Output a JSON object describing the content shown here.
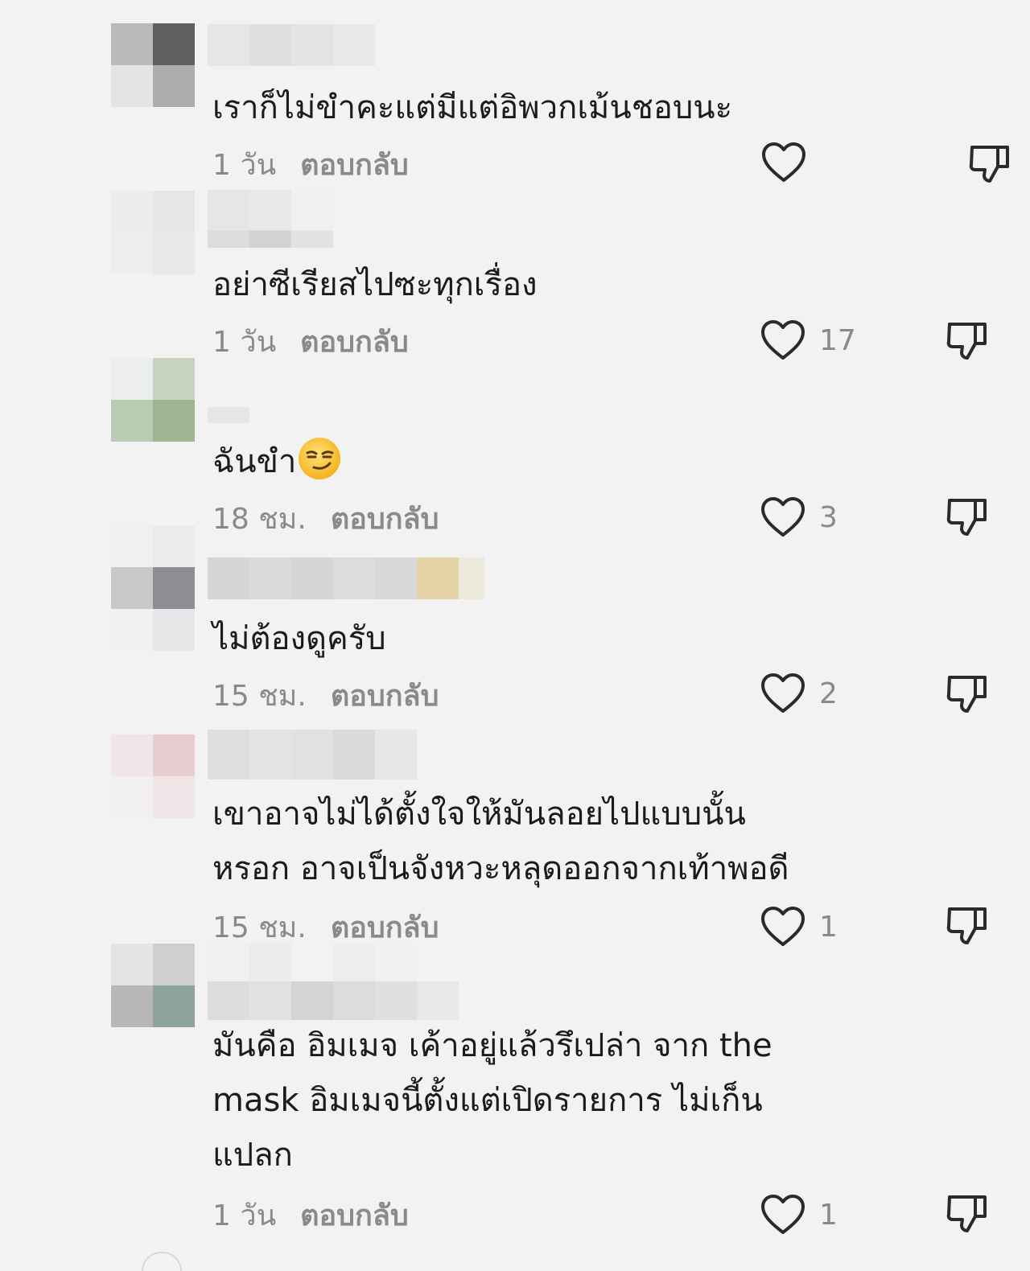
{
  "comments": [
    {
      "text": "เราก็ไม่ขำคะแต่มีแต่อิพวกเม้นชอบนะ",
      "time": "1 วัน",
      "reply": "ตอบกลับ",
      "likes": ""
    },
    {
      "text": "อย่าซีเรียสไปซะทุกเรื่อง",
      "time": "1 วัน",
      "reply": "ตอบกลับ",
      "likes": "17"
    },
    {
      "text": "ฉันขำ",
      "time": "18 ชม.",
      "reply": "ตอบกลับ",
      "likes": "3"
    },
    {
      "text": "ไม่ต้องดูครับ",
      "time": "15 ชม.",
      "reply": "ตอบกลับ",
      "likes": "2"
    },
    {
      "text": "เขาอาจไม่ได้ตั้งใจให้มันลอยไปแบบนั้น\nหรอก อาจเป็นจังหวะหลุดออกจากเท้าพอดี",
      "time": "15 ชม.",
      "reply": "ตอบกลับ",
      "likes": "1"
    },
    {
      "text": "มันคือ อิมเมจ เค้าอยู่แล้วรึเปล่า จาก the\nmask อิมเมจนี้ตั้งแต่เปิดรายการ ไม่เก็น\nแปลก",
      "time": "1 วัน",
      "reply": "ตอบกลับ",
      "likes": "1"
    }
  ],
  "emoji": "smirking-face-emoji",
  "icons": {
    "like": "heart-outline-icon",
    "dislike": "thumbs-down-outline-icon"
  },
  "colors": {
    "background": "#f2f2f3",
    "text": "#1b1b1b",
    "muted": "#8a8a8a"
  }
}
